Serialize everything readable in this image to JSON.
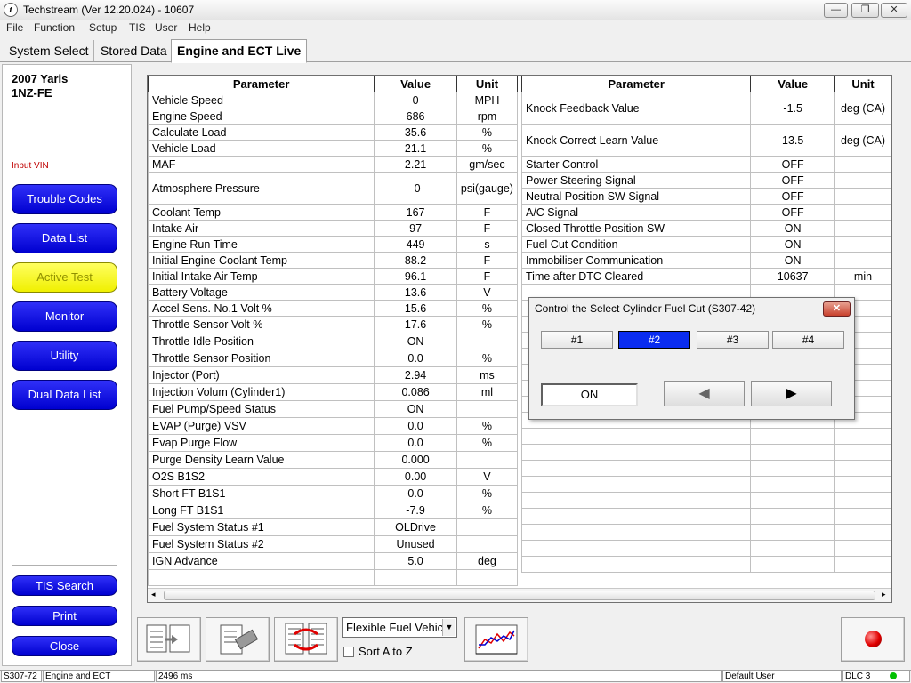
{
  "window": {
    "title": "Techstream (Ver 12.20.024) - 10607",
    "app_icon": "t",
    "minimize": "—",
    "maximize": "❐",
    "close": "✕"
  },
  "menu": [
    "File",
    "Function",
    "Setup",
    "TIS",
    "User",
    "Help"
  ],
  "tabs": [
    "System Select",
    "Stored Data",
    "Engine and ECT Live"
  ],
  "vehicle": {
    "model": "2007 Yaris",
    "engine": "1NZ-FE",
    "input_vin": "Input VIN"
  },
  "nav_buttons": [
    "Trouble Codes",
    "Data List",
    "Active Test",
    "Monitor",
    "Utility",
    "Dual Data List"
  ],
  "bottom_buttons": [
    "TIS Search",
    "Print",
    "Close"
  ],
  "table_headers": {
    "parameter": "Parameter",
    "value": "Value",
    "unit": "Unit"
  },
  "left_rows": [
    {
      "p": "Vehicle Speed",
      "v": "0",
      "u": "MPH"
    },
    {
      "p": "Engine Speed",
      "v": "686",
      "u": "rpm"
    },
    {
      "p": "Calculate Load",
      "v": "35.6",
      "u": "%"
    },
    {
      "p": "Vehicle Load",
      "v": "21.1",
      "u": "%"
    },
    {
      "p": "MAF",
      "v": "2.21",
      "u": "gm/sec"
    },
    {
      "p": "Atmosphere Pressure",
      "v": "-0",
      "u": "psi(gauge)"
    },
    {
      "p": "Coolant Temp",
      "v": "167",
      "u": "F"
    },
    {
      "p": "Intake Air",
      "v": "97",
      "u": "F"
    },
    {
      "p": "Engine Run Time",
      "v": "449",
      "u": "s"
    },
    {
      "p": "Initial Engine Coolant Temp",
      "v": "88.2",
      "u": "F"
    },
    {
      "p": "Initial Intake Air Temp",
      "v": "96.1",
      "u": "F"
    },
    {
      "p": "Battery Voltage",
      "v": "13.6",
      "u": "V"
    },
    {
      "p": "Accel Sens. No.1 Volt %",
      "v": "15.6",
      "u": "%"
    },
    {
      "p": "Throttle Sensor Volt %",
      "v": "17.6",
      "u": "%"
    },
    {
      "p": "Throttle Idle Position",
      "v": "ON",
      "u": ""
    },
    {
      "p": "Throttle Sensor Position",
      "v": "0.0",
      "u": "%"
    },
    {
      "p": "Injector (Port)",
      "v": "2.94",
      "u": "ms"
    },
    {
      "p": "Injection Volum (Cylinder1)",
      "v": "0.086",
      "u": "ml"
    },
    {
      "p": "Fuel Pump/Speed Status",
      "v": "ON",
      "u": ""
    },
    {
      "p": "EVAP (Purge) VSV",
      "v": "0.0",
      "u": "%"
    },
    {
      "p": "Evap Purge Flow",
      "v": "0.0",
      "u": "%"
    },
    {
      "p": "Purge Density Learn Value",
      "v": "0.000",
      "u": ""
    },
    {
      "p": "O2S B1S2",
      "v": "0.00",
      "u": "V"
    },
    {
      "p": "Short FT B1S1",
      "v": "0.0",
      "u": "%"
    },
    {
      "p": "Long FT B1S1",
      "v": "-7.9",
      "u": "%"
    },
    {
      "p": "Fuel System Status #1",
      "v": "OLDrive",
      "u": ""
    },
    {
      "p": "Fuel System Status #2",
      "v": "Unused",
      "u": ""
    },
    {
      "p": "IGN Advance",
      "v": "5.0",
      "u": "deg"
    }
  ],
  "right_rows": [
    {
      "p": "Knock Feedback Value",
      "v": "-1.5",
      "u": "deg (CA)"
    },
    {
      "p": "Knock Correct Learn Value",
      "v": "13.5",
      "u": "deg (CA)"
    },
    {
      "p": "Starter Control",
      "v": "OFF",
      "u": ""
    },
    {
      "p": "Power Steering Signal",
      "v": "OFF",
      "u": ""
    },
    {
      "p": "Neutral Position SW Signal",
      "v": "OFF",
      "u": ""
    },
    {
      "p": "A/C Signal",
      "v": "OFF",
      "u": ""
    },
    {
      "p": "Closed Throttle Position SW",
      "v": "ON",
      "u": ""
    },
    {
      "p": "Fuel Cut Condition",
      "v": "ON",
      "u": ""
    },
    {
      "p": "Immobiliser Communication",
      "v": "ON",
      "u": ""
    },
    {
      "p": "Time after DTC Cleared",
      "v": "10637",
      "u": "min"
    }
  ],
  "dialog": {
    "title": "Control the Select Cylinder Fuel Cut (S307-42)",
    "close": "✕",
    "cylinders": [
      "#1",
      "#2",
      "#3",
      "#4"
    ],
    "selected": "#2",
    "state": "ON",
    "prev": "◀",
    "next": "▶"
  },
  "toolbar": {
    "fuel_select": "Flexible Fuel Vehicle",
    "sort_label": "Sort A to Z",
    "sort_checked": false
  },
  "status": {
    "code": "S307-72",
    "system": "Engine and ECT",
    "time": "2496 ms",
    "user": "Default User",
    "dlc": "DLC 3"
  },
  "colors": {
    "nav_button": "#0000d0",
    "active_button": "#f0f000",
    "selected_cylinder": "#0a2cf0",
    "record": "#e00000",
    "dlc_ok": "#00c000"
  }
}
